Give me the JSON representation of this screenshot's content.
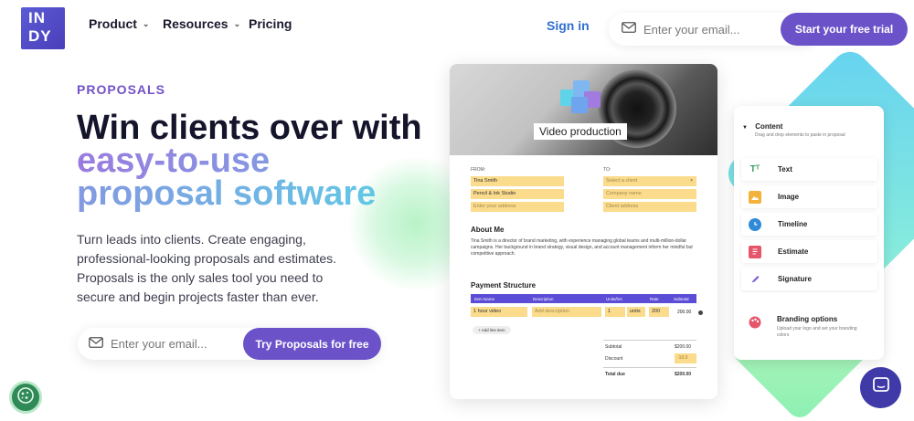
{
  "header": {
    "logo_line1": "IN",
    "logo_line2": "DY",
    "nav": [
      {
        "label": "Product",
        "has_dropdown": true
      },
      {
        "label": "Resources",
        "has_dropdown": true
      },
      {
        "label": "Pricing",
        "has_dropdown": false
      }
    ],
    "sign_in": "Sign in",
    "email_placeholder": "Enter your email...",
    "cta": "Start your free trial"
  },
  "hero": {
    "eyebrow": "PROPOSALS",
    "headline_plain": "Win clients over with",
    "headline_gradient": "easy-to-use proposal software",
    "description": "Turn leads into clients. Create engaging, professional-looking proposals and estimates. Proposals is the only sales tool you need to secure and begin projects faster than ever.",
    "email_placeholder": "Enter your email...",
    "cta": "Try Proposals for free"
  },
  "proposal_card": {
    "photo_label": "Video production",
    "from_label": "FROM:",
    "to_label": "TO:",
    "from_name": "Tina Smith",
    "from_company": "Pencil & Ink Studio",
    "from_address": "Enter your address",
    "to_client": "Select a client",
    "to_company": "Company name",
    "to_address": "Client address",
    "about_title": "About Me",
    "about_text": "Tina Smith is a director of brand marketing, with experience managing global teams and multi-million-dollar campaigns. Her background in brand strategy, visual design, and account management inform her mindful but competitive approach.",
    "payment_title": "Payment Structure",
    "table_headers": [
      "Item Name",
      "Description",
      "Units/hrs",
      "Rate",
      "Subtotal"
    ],
    "row": {
      "item": "1 hour video",
      "description": "Add description",
      "units": "1",
      "unit_type": "units",
      "rate": "200",
      "subtotal": "200.00"
    },
    "add_line": "+ Add line item",
    "subtotal_label": "Subtotal",
    "subtotal_value": "$200.00",
    "discount_label": "Discount",
    "discount_value": "-10.0",
    "total_label": "Total due",
    "total_value": "$200.00"
  },
  "side_panel": {
    "title": "Content",
    "subtitle": "Drag and drop elements to paste in proposal",
    "items": [
      {
        "label": "Text",
        "icon": "text-icon",
        "color": "#3a9a5c"
      },
      {
        "label": "Image",
        "icon": "image-icon",
        "color": "#f3b23d"
      },
      {
        "label": "Timeline",
        "icon": "timeline-icon",
        "color": "#2f8ad8"
      },
      {
        "label": "Estimate",
        "icon": "estimate-icon",
        "color": "#e5566b"
      },
      {
        "label": "Signature",
        "icon": "signature-icon",
        "color": "#7d5ad0"
      }
    ],
    "branding_title": "Branding options",
    "branding_sub": "Upload your logo and set your branding colors"
  },
  "colors": {
    "brand_purple": "#6b52c9",
    "link_blue": "#2f6fd1",
    "highlight_yellow": "#fbdb8c"
  }
}
